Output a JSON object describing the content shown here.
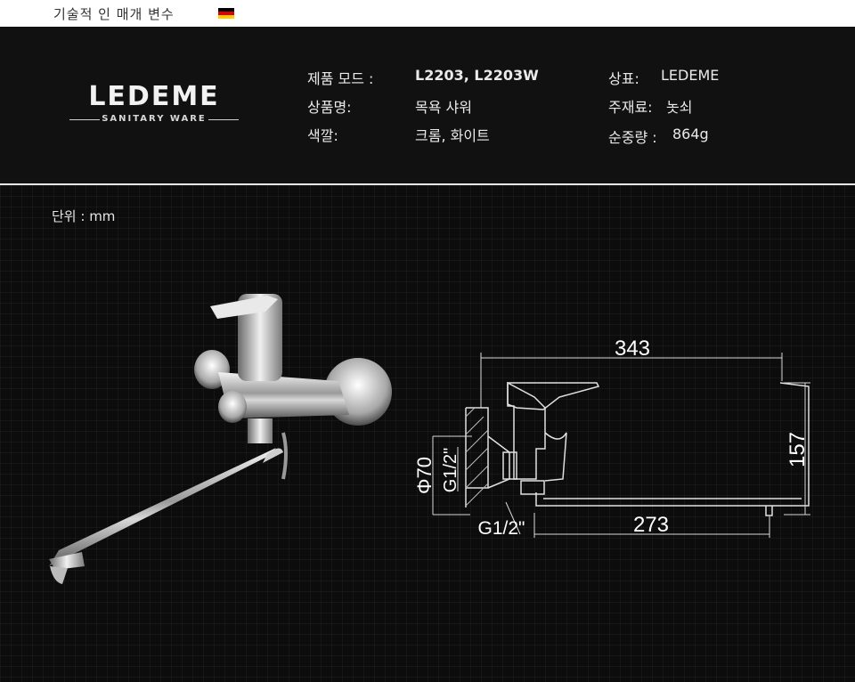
{
  "topbar": {
    "title": "기술적 인 매개 변수",
    "flag_colors": [
      "#000000",
      "#dd0000",
      "#ffce00"
    ]
  },
  "logo": {
    "brand": "LEDEME",
    "subtitle": "SANITARY WARE"
  },
  "specs": {
    "model_label": "제품 모드 :",
    "model_value": "L2203, L2203W",
    "name_label": "상품명:",
    "name_value": "목욕 샤워",
    "color_label": "색깔:",
    "color_value": "크롬, 화이트",
    "brand_label": "상표:",
    "brand_value": "LEDEME",
    "material_label": "주재료:",
    "material_value": "놋쇠",
    "weight_label": "순중량 :",
    "weight_value": "864g"
  },
  "drawing": {
    "unit_label": "단위 : mm",
    "dims": {
      "total_width": "343",
      "height": "157",
      "spout": "273",
      "diameter": "Φ70",
      "thread_upper": "G1/2\"",
      "thread_lower": "G1/2\""
    }
  }
}
